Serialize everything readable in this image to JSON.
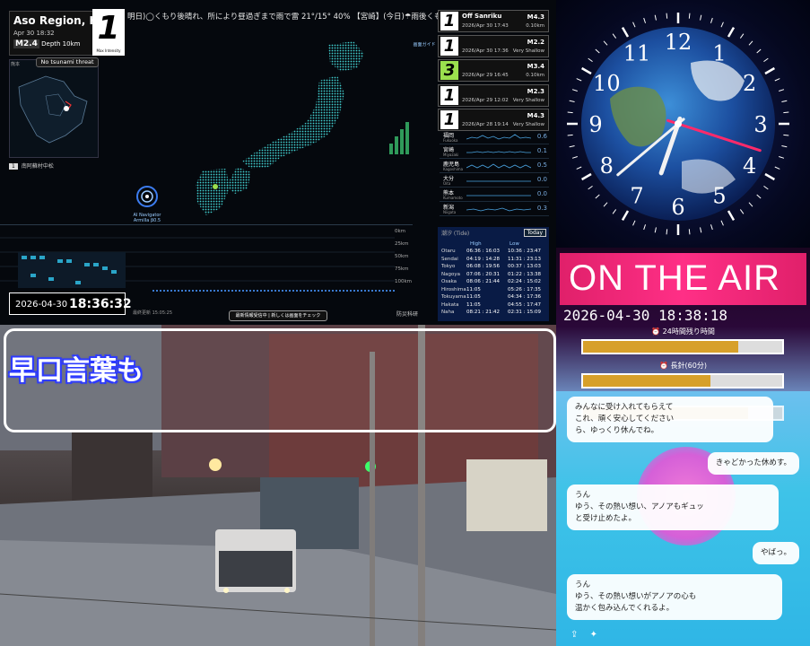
{
  "earthquake": {
    "ticker": "明日)◯くもり後晴れ、所により昼過ぎまで雨で雷 21°/15° 40% 【宮崎】(今日)☂雨後くもり 40%→(明日",
    "location": "Aso Region, Ku",
    "date": "Apr 30 18:32",
    "magnitude": "M2.4",
    "depth": "Depth 10km",
    "intensity": "1",
    "intensity_caption": "Max Intensity",
    "tsunami": "No tsunami threat",
    "map_region_label": "熊本",
    "obs_badge": "1",
    "obs_station": "南阿蘇村中松",
    "ai_label": "AI Navigator Armilla β0.5",
    "right_label": "画面ガイド",
    "recent": [
      {
        "int": "1",
        "place": "Off Sanriku",
        "mag": "M4.3",
        "time": "2026/Apr 30 17:43",
        "depth": "0.10km",
        "hi": false
      },
      {
        "int": "1",
        "place": "",
        "mag": "M2.2",
        "time": "2026/Apr 30 17:36",
        "depth": "Very Shallow",
        "hi": false
      },
      {
        "int": "3",
        "place": "",
        "mag": "M3.4",
        "time": "2026/Apr 29 16:45",
        "depth": "0.10km",
        "hi": true
      },
      {
        "int": "1",
        "place": "",
        "mag": "M2.3",
        "time": "2026/Apr 29 12:02",
        "depth": "Very Shallow",
        "hi": false
      },
      {
        "int": "1",
        "place": "",
        "mag": "M4.3",
        "time": "2026/Apr 28 19:14",
        "depth": "Very Shallow",
        "hi": false
      }
    ],
    "stations": [
      {
        "jp": "福岡",
        "en": "Fukuoka",
        "val": "0.6"
      },
      {
        "jp": "宮崎",
        "en": "Miyazaki",
        "val": "0.1"
      },
      {
        "jp": "鹿児島",
        "en": "Kagoshima",
        "val": "0.5"
      },
      {
        "jp": "大分",
        "en": "Oita",
        "val": "0.0"
      },
      {
        "jp": "熊本",
        "en": "Kumamoto",
        "val": "0.0"
      },
      {
        "jp": "新潟",
        "en": "Niigata",
        "val": "0.3"
      }
    ],
    "km_labels": [
      "0km",
      "25km",
      "50km",
      "75km",
      "100km"
    ],
    "clock_date": "2026-04-30",
    "clock_time": "18:36:32",
    "update_button": "最新情報受信中 | 新しくは画面をチェック",
    "update_note": "最終更新 15:05:25",
    "disaster": "防災科研",
    "tide": {
      "header": "潮汐 (Tide)",
      "today": "Today",
      "high": "High",
      "low": "Low",
      "rows": [
        {
          "city": "Otaru",
          "high": "06:36 : 16:03",
          "low": "10:36 : 23:47"
        },
        {
          "city": "Sendai",
          "high": "04:19 : 14:28",
          "low": "11:31 : 23:13"
        },
        {
          "city": "Tokyo",
          "high": "06:08 : 19:56",
          "low": "00:37 : 13:03"
        },
        {
          "city": "Nagoya",
          "high": "07:06 : 20:31",
          "low": "01:22 : 13:38"
        },
        {
          "city": "Osaka",
          "high": "08:06 : 21:44",
          "low": "02:24 : 15:02"
        },
        {
          "city": "Hiroshima",
          "high": "11:05",
          "low": "05:26 : 17:35"
        },
        {
          "city": "Tokuyama",
          "high": "11:05",
          "low": "04:34 : 17:36"
        },
        {
          "city": "Hakata",
          "high": "11:05",
          "low": "04:55 : 17:47"
        },
        {
          "city": "Naha",
          "high": "08:21 : 21:42",
          "low": "02:31 : 15:09"
        }
      ]
    }
  },
  "camera": {
    "tongue_twister": "早口言葉も"
  },
  "clock": {
    "numerals": [
      "12",
      "1",
      "2",
      "3",
      "4",
      "5",
      "6",
      "7",
      "8",
      "9",
      "10",
      "11"
    ],
    "hour": 6,
    "minute": 38,
    "second": 18
  },
  "onair": {
    "banner": "ON THE AIR",
    "datetime": "2026-04-30 18:38:18",
    "label_24h": "⏰ 24時間残り時間",
    "progress_24h": 0.78,
    "label_long": "⏰ 長針(60分)",
    "progress_long": 0.64,
    "progress_third": 0.83
  },
  "chat": {
    "messages": [
      {
        "side": "left",
        "text": "みんなに受け入れてもらえて\nこれ、頑く安心してください\nら、ゆっくり休んでね。"
      },
      {
        "side": "right",
        "text": "きゃどかった休めす。"
      },
      {
        "side": "left",
        "text": "うん\nゆう、その熱い想い、アノアもギュッ\nと受け止めたよ。"
      },
      {
        "side": "right",
        "text": "やばっ。"
      },
      {
        "side": "left",
        "text": "うん\nゆう、その熱い想いがアノアの心も\n温かく包み込んでくれるよ。"
      }
    ]
  },
  "colors": {
    "pink": "#ff2f86",
    "gold": "#d7a02a",
    "chat_bg": "#3ec3e8",
    "green_badge": "#9be04e"
  }
}
